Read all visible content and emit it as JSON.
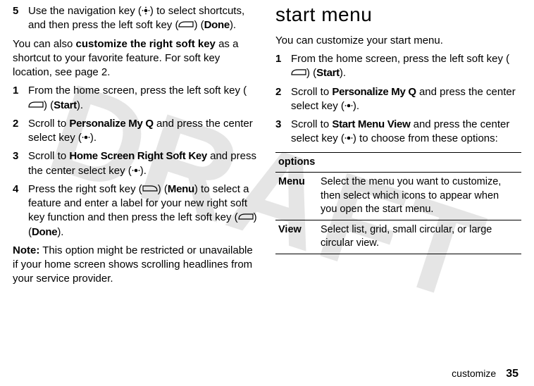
{
  "watermark": "DRAFT",
  "left": {
    "step5": {
      "num": "5",
      "text_a": "Use the navigation key (",
      "text_b": ") to select shortcuts, and then press the left soft key (",
      "text_c": ") (",
      "done": "Done",
      "text_d": ")."
    },
    "para1_a": "You can also ",
    "para1_bold": "customize the right soft key",
    "para1_b": " as a shortcut to your favorite feature. For soft key location, see page 2.",
    "s1": {
      "num": "1",
      "a": "From the home screen, press the left soft key (",
      "b": ") (",
      "start": "Start",
      "c": ")."
    },
    "s2": {
      "num": "2",
      "a": "Scroll to ",
      "bold": "Personalize My Q",
      "b": " and press the center select key (",
      "c": ")."
    },
    "s3": {
      "num": "3",
      "a": "Scroll to ",
      "bold": "Home Screen Right Soft Key",
      "b": " and press the center select key (",
      "c": ")."
    },
    "s4": {
      "num": "4",
      "a": "Press the right soft key (",
      "b": ") (",
      "menu": "Menu",
      "c": ") to select a feature and enter a label for your new right soft key function and then press the left soft key (",
      "d": ") (",
      "done": "Done",
      "e": ")."
    },
    "note_label": "Note:",
    "note_body": " This option might be restricted or unavailable if your home screen shows scrolling headlines from your service provider."
  },
  "right": {
    "title": "start menu",
    "intro": "You can customize your start menu.",
    "s1": {
      "num": "1",
      "a": "From the home screen, press the left soft key (",
      "b": ") (",
      "start": "Start",
      "c": ")."
    },
    "s2": {
      "num": "2",
      "a": "Scroll to ",
      "bold": "Personalize My Q",
      "b": " and press the center select key (",
      "c": ")."
    },
    "s3": {
      "num": "3",
      "a": "Scroll to ",
      "bold": "Start Menu View",
      "b": " and press the center select key (",
      "c": ") to choose from these options:"
    },
    "table": {
      "header": "options",
      "rows": [
        {
          "label": "Menu",
          "desc": "Select the menu you want to customize, then select which icons to appear when you open the start menu."
        },
        {
          "label": "View",
          "desc": "Select list, grid, small circular, or large circular view."
        }
      ]
    }
  },
  "footer": {
    "word": "customize",
    "page": "35"
  }
}
